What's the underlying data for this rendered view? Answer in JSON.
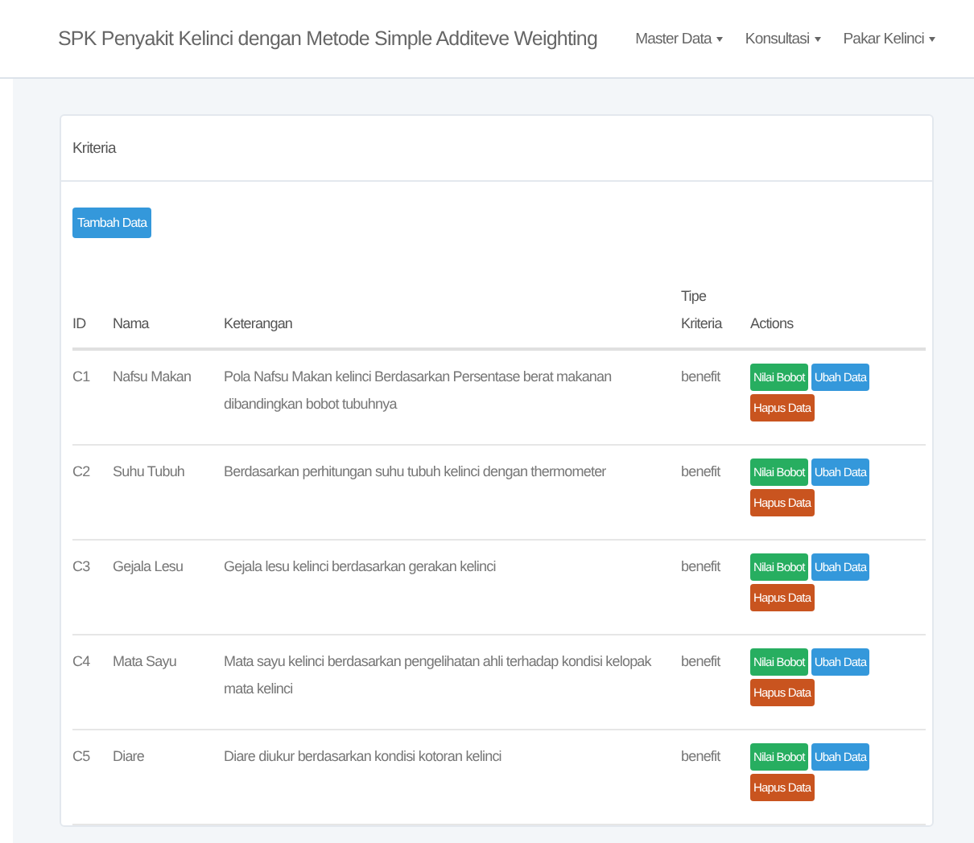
{
  "navbar": {
    "brand": "SPK Penyakit Kelinci dengan Metode Simple Additeve Weighting",
    "menus": [
      "Master Data",
      "Konsultasi",
      "Pakar Kelinci"
    ]
  },
  "panel": {
    "title": "Kriteria",
    "add_button": "Tambah Data",
    "table": {
      "columns": [
        "ID",
        "Nama",
        "Keterangan",
        "Tipe Kriteria",
        "Actions"
      ],
      "rows": [
        {
          "id": "C1",
          "nama": "Nafsu Makan",
          "keterangan": "Pola Nafsu Makan kelinci Berdasarkan Persentase berat makanan dibandingkan bobot tubuhnya",
          "tipe": "benefit",
          "actions": [
            {
              "kind": "weight",
              "label": "Nilai Bobot"
            },
            {
              "kind": "edit",
              "label": "Ubah Data"
            },
            {
              "kind": "delete",
              "label": "Hapus Data"
            }
          ]
        },
        {
          "id": "C2",
          "nama": "Suhu Tubuh",
          "keterangan": "Berdasarkan perhitungan suhu tubuh kelinci dengan thermometer",
          "tipe": "benefit",
          "actions": [
            {
              "kind": "weight",
              "label": "Nilai Bobot"
            },
            {
              "kind": "edit",
              "label": "Ubah Data"
            },
            {
              "kind": "delete",
              "label": "Hapus Data"
            }
          ]
        },
        {
          "id": "C3",
          "nama": "Gejala Lesu",
          "keterangan": "Gejala lesu kelinci berdasarkan gerakan kelinci",
          "tipe": "benefit",
          "actions": [
            {
              "kind": "weight",
              "label": "Nilai Bobot"
            },
            {
              "kind": "edit",
              "label": "Ubah Data"
            },
            {
              "kind": "delete",
              "label": "Hapus Data"
            }
          ]
        },
        {
          "id": "C4",
          "nama": "Mata Sayu",
          "keterangan": "Mata sayu kelinci berdasarkan pengelihatan ahli terhadap kondisi kelopak mata kelinci",
          "tipe": "benefit",
          "actions": [
            {
              "kind": "weight",
              "label": "Nilai Bobot"
            },
            {
              "kind": "edit",
              "label": "Ubah Data"
            },
            {
              "kind": "delete",
              "label": "Hapus Data"
            }
          ]
        },
        {
          "id": "C5",
          "nama": "Diare",
          "keterangan": "Diare diukur berdasarkan kondisi kotoran kelinci",
          "tipe": "benefit",
          "actions": [
            {
              "kind": "weight",
              "label": "Nilai Bobot"
            },
            {
              "kind": "edit",
              "label": "Ubah Data"
            },
            {
              "kind": "delete",
              "label": "Hapus Data"
            }
          ]
        }
      ]
    }
  }
}
